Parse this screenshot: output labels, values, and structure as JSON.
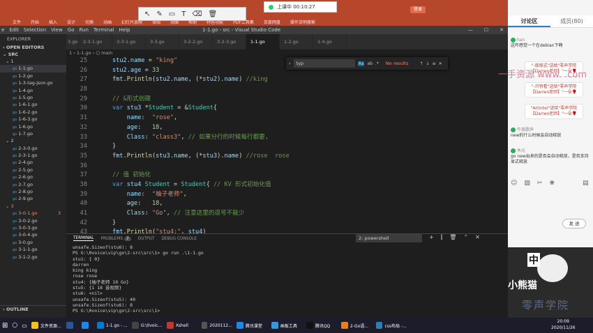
{
  "ppt": {
    "menu": [
      "文件",
      "开始",
      "插入",
      "设计",
      "切换",
      "动画",
      "幻灯片放映",
      "审阅",
      "视图",
      "帮助",
      "特色功能",
      "PDF工具集",
      "百度网盘",
      "操作说明搜索"
    ],
    "login": "登录",
    "share": "共享"
  },
  "annotation_toolbar": {
    "tools": [
      "pointer-icon",
      "pen-icon",
      "rect-icon",
      "text-icon",
      "eraser-icon",
      "delete-icon"
    ]
  },
  "live": {
    "status": "上课中 00:10:27"
  },
  "vscode": {
    "menu": [
      "e",
      "Edit",
      "Selection",
      "View",
      "Go",
      "Run",
      "Terminal",
      "Help"
    ],
    "title": "1-1.go - src - Visual Studio Code",
    "explorer_title": "EXPLORER",
    "open_editors": "OPEN EDITORS",
    "src": "SRC",
    "tree": [
      {
        "label": "1",
        "type": "folder"
      },
      {
        "label": "1-1.go",
        "type": "file",
        "active": true
      },
      {
        "label": "1-2.go",
        "type": "file"
      },
      {
        "label": "1-3-tag-json.go",
        "type": "file"
      },
      {
        "label": "1-4.go",
        "type": "file"
      },
      {
        "label": "1-5.go",
        "type": "file"
      },
      {
        "label": "1-6-1.go",
        "type": "file"
      },
      {
        "label": "1-6-2.go",
        "type": "file"
      },
      {
        "label": "1-6-3.go",
        "type": "file"
      },
      {
        "label": "1-6.go",
        "type": "file"
      },
      {
        "label": "1-7.go",
        "type": "file"
      },
      {
        "label": "2",
        "type": "folder"
      },
      {
        "label": "2-3-0.go",
        "type": "file"
      },
      {
        "label": "2-3-1.go",
        "type": "file"
      },
      {
        "label": "2-4.go",
        "type": "file"
      },
      {
        "label": "2-5.go",
        "type": "file"
      },
      {
        "label": "2-6.go",
        "type": "file"
      },
      {
        "label": "2-7.go",
        "type": "file"
      },
      {
        "label": "2-8.go",
        "type": "file"
      },
      {
        "label": "2-9.go",
        "type": "file"
      },
      {
        "label": "3",
        "type": "folder",
        "err": true
      },
      {
        "label": "3-0-1.go",
        "type": "file",
        "err": true,
        "badge": "3"
      },
      {
        "label": "3-0-2.go",
        "type": "file"
      },
      {
        "label": "3-0-3.go",
        "type": "file"
      },
      {
        "label": "3-0-4.go",
        "type": "file"
      },
      {
        "label": "3-0.go",
        "type": "file"
      },
      {
        "label": "3-1-1.go",
        "type": "file"
      },
      {
        "label": "3-1-2.go",
        "type": "file"
      }
    ],
    "outline": "OUTLINE",
    "tabs": [
      "3.go",
      "2-3-1.go",
      "3-3-1.go",
      "3-3.go",
      "3-2-2.go",
      "3-2-3.go",
      "1-1.go",
      "1-2.go",
      "1-4.go"
    ],
    "active_tab": 6,
    "breadcrumb": "1 › 1-1.go › ⬡ main",
    "find": {
      "value": "typ",
      "case": "Aa",
      "word": "ab",
      "regex": ".*",
      "result": "No results",
      "prev": "↑",
      "next": "↓",
      "sel": "≡",
      "close": "✕"
    },
    "code": [
      {
        "ln": "25",
        "html": "<span class='v'>stu2</span>.<span class='v'>name</span> = <span class='s'>\"king\"</span>"
      },
      {
        "ln": "26",
        "html": "<span class='v'>stu2</span>.<span class='v'>age</span> = <span class='n'>33</span>"
      },
      {
        "ln": "27",
        "html": "<span class='v'>fmt</span>.<span class='f'>Println</span>(<span class='v'>stu2</span>.<span class='v'>name</span>, (*<span class='v'>stu2</span>).<span class='v'>name</span>) <span class='c'>//king</span>"
      },
      {
        "ln": "28",
        "html": ""
      },
      {
        "ln": "29",
        "html": "<span class='c'>// &amp;形式创建</span>"
      },
      {
        "ln": "30",
        "html": "<span class='k'>var</span> <span class='v'>stu3</span> *<span class='t'>Student</span> = &amp;<span class='t'>Student</span>{"
      },
      {
        "ln": "31",
        "html": "    <span class='v'>name</span>:  <span class='s'>\"rose\"</span>,"
      },
      {
        "ln": "32",
        "html": "    <span class='v'>age</span>:   <span class='n'>18</span>,"
      },
      {
        "ln": "33",
        "html": "    <span class='v'>Class</span>: <span class='s'>\"class3\"</span>, <span class='c'>// 如果分行的时候每行都要,</span>"
      },
      {
        "ln": "34",
        "html": "}"
      },
      {
        "ln": "35",
        "html": "<span class='v'>fmt</span>.<span class='f'>Println</span>(<span class='v'>stu3</span>.<span class='v'>name</span>, (*<span class='v'>stu3</span>).<span class='v'>name</span>) <span class='c'>//rose  rose</span>"
      },
      {
        "ln": "36",
        "html": ""
      },
      {
        "ln": "37",
        "html": "<span class='c'>// 值 初始化</span>"
      },
      {
        "ln": "38",
        "html": "<span class='k'>var</span> <span class='v'>stu4</span> <span class='t'>Student</span> = <span class='t'>Student</span>{ <span class='c'>// KV 形式初始化值</span>"
      },
      {
        "ln": "39",
        "html": "    <span class='v'>name</span>:  <span class='s'>\"柚子老师\"</span>,"
      },
      {
        "ln": "40",
        "html": "    <span class='v'>age</span>:   <span class='n'>18</span>,"
      },
      {
        "ln": "41",
        "html": "    <span class='v'>Class</span>: <span class='s'>\"Go\"</span>, <span class='c'>// 注意这里的逗号不能少</span>"
      },
      {
        "ln": "42",
        "html": "}"
      },
      {
        "ln": "43",
        "html": "<span class='v'>fmt</span>.<span class='f'>Println</span>(<span class='s'>\"stu4:\"</span>, <span class='v'>stu4</span>)"
      }
    ],
    "panel": {
      "terminal": "TERMINAL",
      "problems": "PROBLEMS",
      "problems_count": "7",
      "output": "OUTPUT",
      "debug": "DEBUG CONSOLE",
      "shell": "2: powershell"
    },
    "terminal": [
      "unsafe.Sizeof(stu6): 8",
      "PS G:\\0voice\\vip\\go\\2-src\\src\\1> go run .\\1-1.go",
      "stu1: { 0}",
      "darren",
      "king king",
      "rose rose",
      "stu4: {柚子老师 18 Go}",
      "stu5: {1 18 音视频}",
      "stu6: <nil>",
      "unsafe.Sizeof(stu5): 40",
      "unsafe.Sizeof(stu6): 8",
      "PS G:\\0voice\\vip\\go\\2-src\\src\\1> "
    ]
  },
  "chat": {
    "tabs": [
      "讨论区",
      "成员(80)"
    ],
    "messages": [
      {
        "name": "han",
        "text": "这咋感觉一个在debian下啊"
      },
      {
        "gift": "\"-般般忒\"送给\"零声学院【Darren老师】\"一朵🌹"
      },
      {
        "gift": "\"-只特看\"送给\"零声学院【Darren老师】\"一朵🌹"
      },
      {
        "gift": "\"Artintel\"送给\"零声学院【Darren老师】\"一朵🌹"
      },
      {
        "name": "午夜歌声",
        "text": "new的什么时候会自动释放"
      },
      {
        "name": "木元",
        "text": "go new出来的是否会自动释放，是否支持显式释放"
      }
    ],
    "watermark": "一手资源 www.  .com",
    "send": "发 送",
    "video_caption": "中",
    "handwriting": "小熊猫",
    "school": "零声学院"
  },
  "taskbar": {
    "items": [
      "文件资源...",
      "",
      "",
      "1-1.go - ...",
      "G:\\0voic...",
      "Xshell",
      "2020112...",
      "腾讯课堂",
      "画板工具",
      "腾讯QQ",
      "2-Go语...",
      "css布局 -..."
    ],
    "time": "20:09",
    "date": "2020/11/26"
  },
  "colors": {
    "accent": "#007acc",
    "ppt": "#b7472a",
    "chat_bg": "#f5f5f5"
  }
}
